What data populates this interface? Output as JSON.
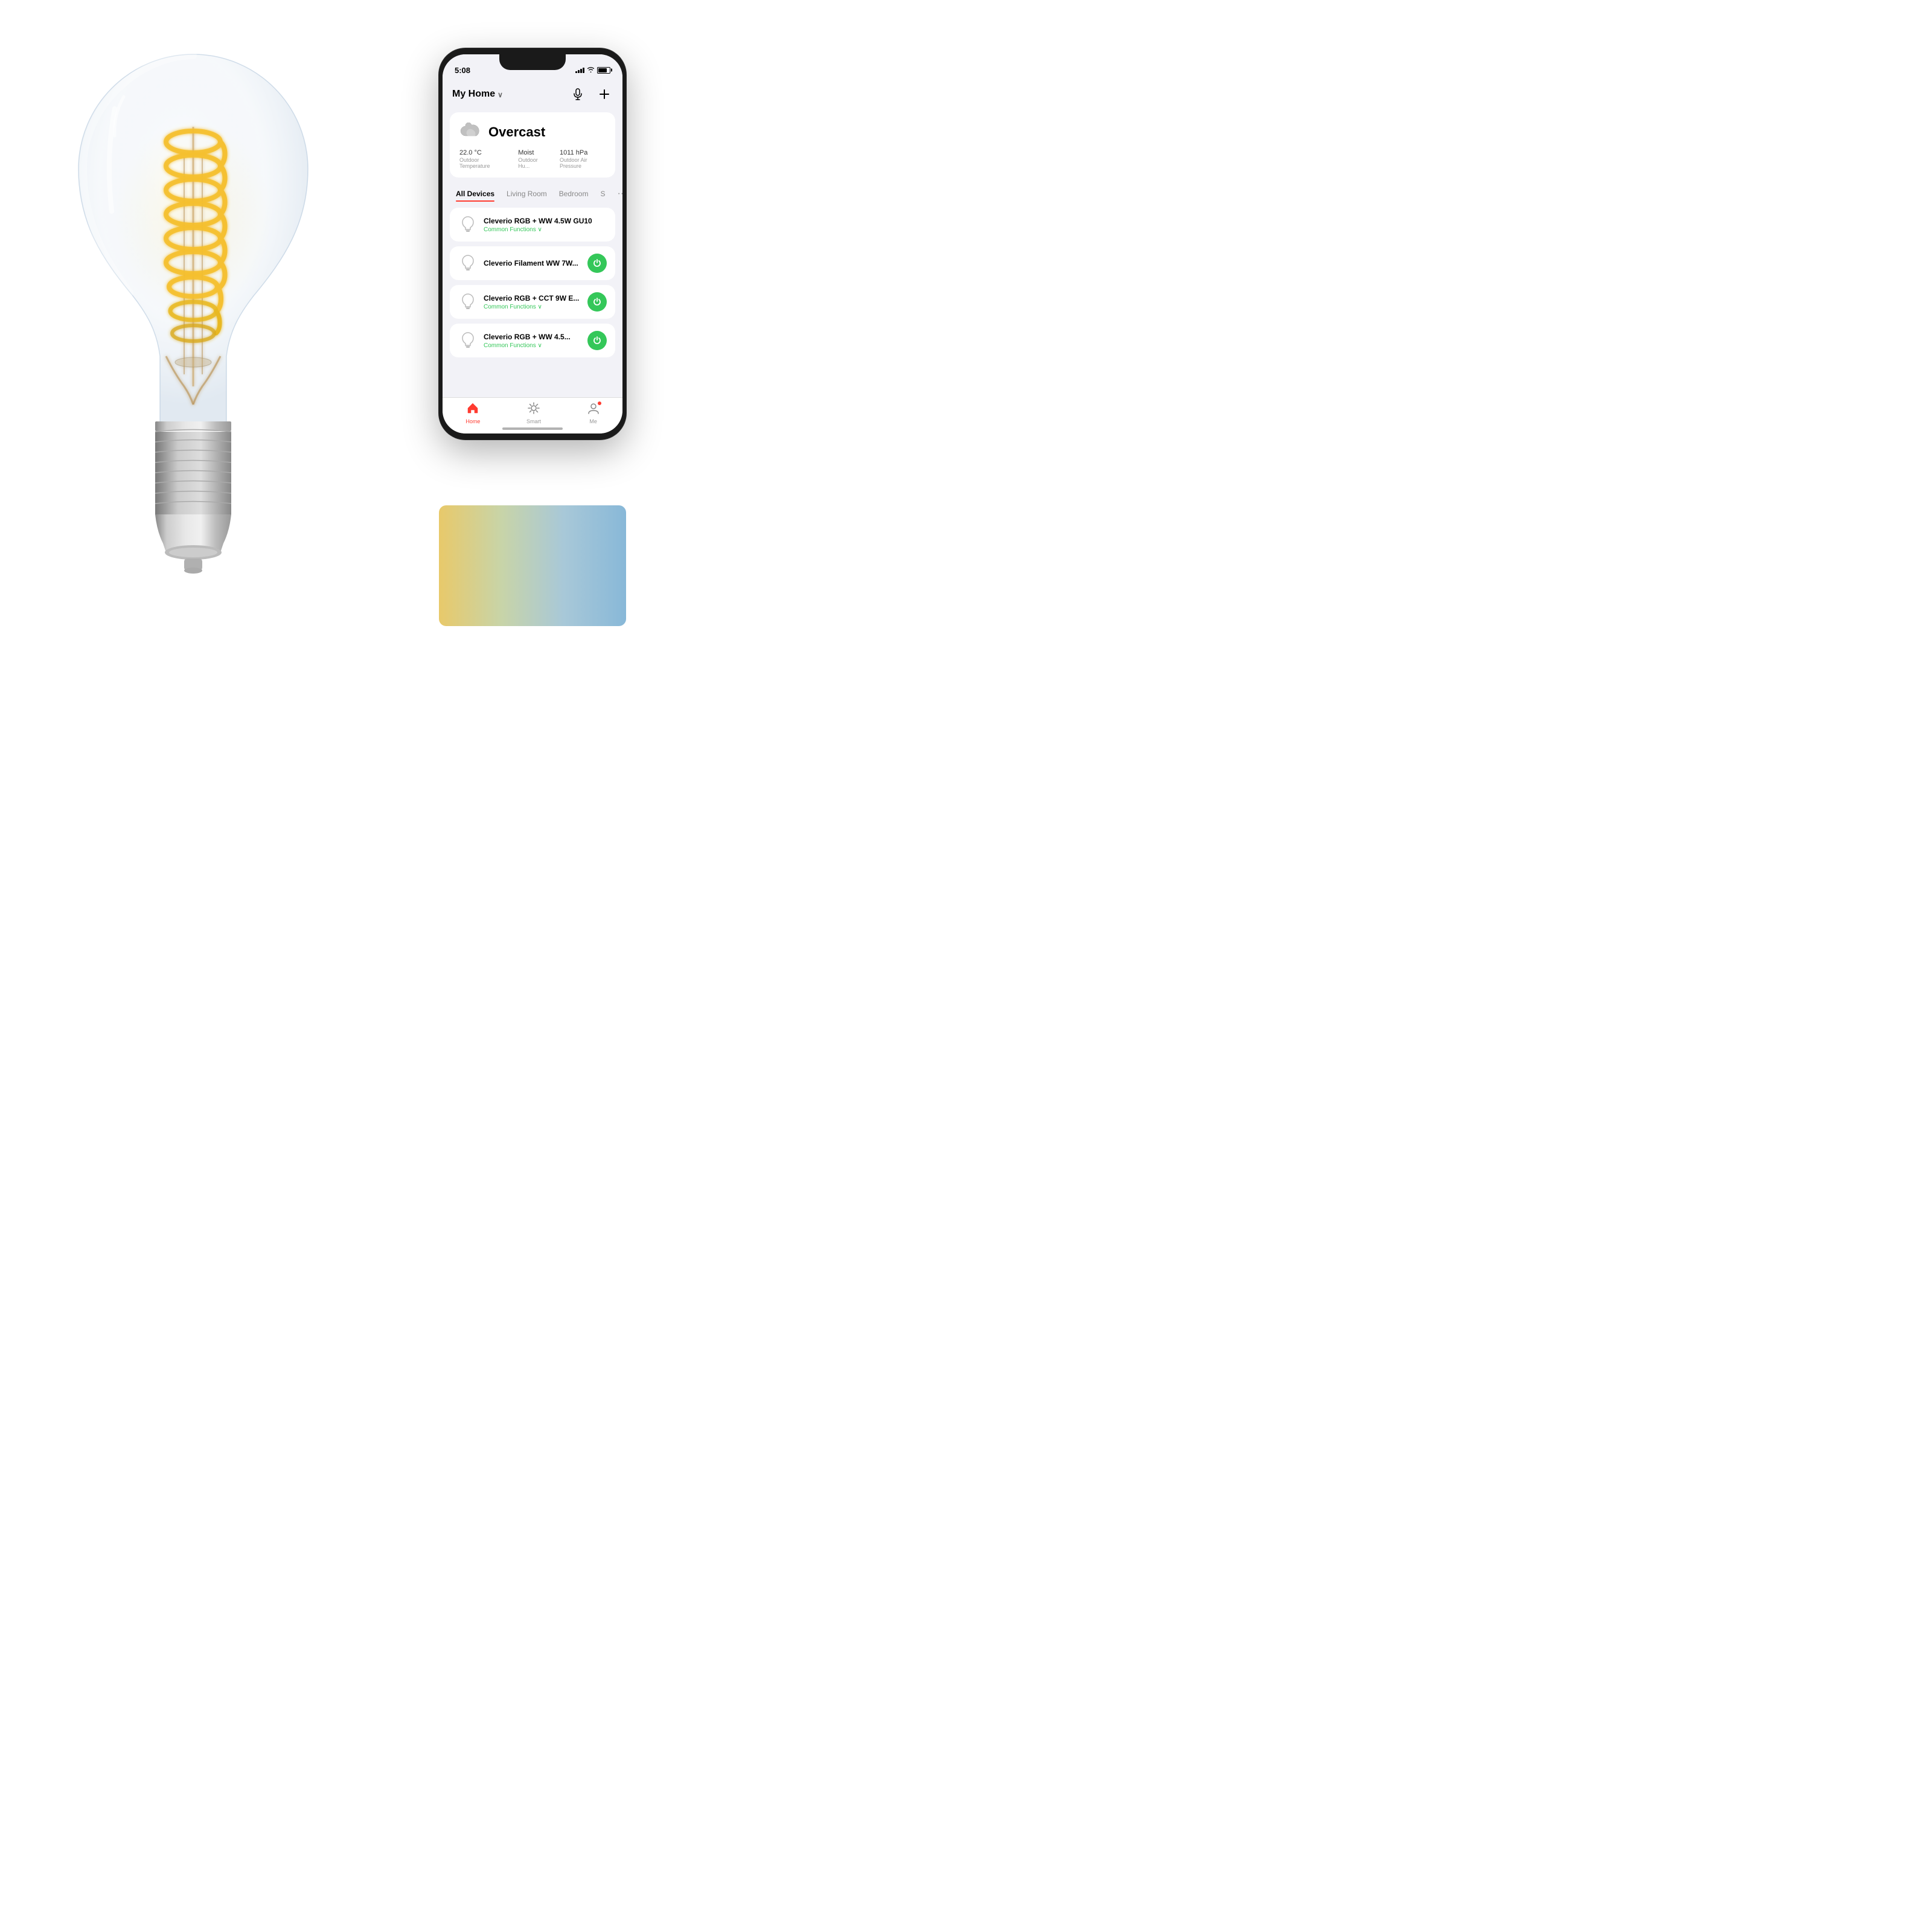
{
  "status_bar": {
    "time": "5:08",
    "signal": [
      3,
      5,
      7,
      9,
      11
    ],
    "battery_pct": 75
  },
  "header": {
    "title": "My Home",
    "chevron": "∨",
    "mic_label": "mic",
    "add_label": "add"
  },
  "weather": {
    "condition": "Overcast",
    "icon": "cloud",
    "stats": [
      {
        "value": "22.0 °C",
        "label": "Outdoor Temperature"
      },
      {
        "value": "Moist",
        "label": "Outdoor Hu..."
      },
      {
        "value": "1011 hPa",
        "label": "Outdoor Air Pressure"
      }
    ]
  },
  "tabs": [
    {
      "label": "All Devices",
      "active": true
    },
    {
      "label": "Living Room",
      "active": false
    },
    {
      "label": "Bedroom",
      "active": false
    },
    {
      "label": "S",
      "active": false
    }
  ],
  "devices": [
    {
      "name": "Cleverio RGB + WW 4.5W GU10",
      "sub": "Common Functions ∨",
      "has_power": false,
      "power_on": false
    },
    {
      "name": "Cleverio Filament WW 7W...",
      "sub": "",
      "has_power": true,
      "power_on": true
    },
    {
      "name": "Cleverio RGB + CCT 9W E...",
      "sub": "Common Functions ∨",
      "has_power": true,
      "power_on": true
    },
    {
      "name": "Cleverio RGB + WW 4.5...",
      "sub": "Common Functions ∨",
      "has_power": true,
      "power_on": true
    }
  ],
  "bottom_nav": [
    {
      "label": "Home",
      "active": true,
      "icon": "🏠"
    },
    {
      "label": "Smart",
      "active": false,
      "icon": "☀"
    },
    {
      "label": "Me",
      "active": false,
      "icon": "👤",
      "has_badge": true
    }
  ],
  "color_swatch": {
    "gradient_start": "#e8c96a",
    "gradient_mid1": "#c8d4a8",
    "gradient_mid2": "#a8c8d8",
    "gradient_end": "#88b8d8"
  }
}
